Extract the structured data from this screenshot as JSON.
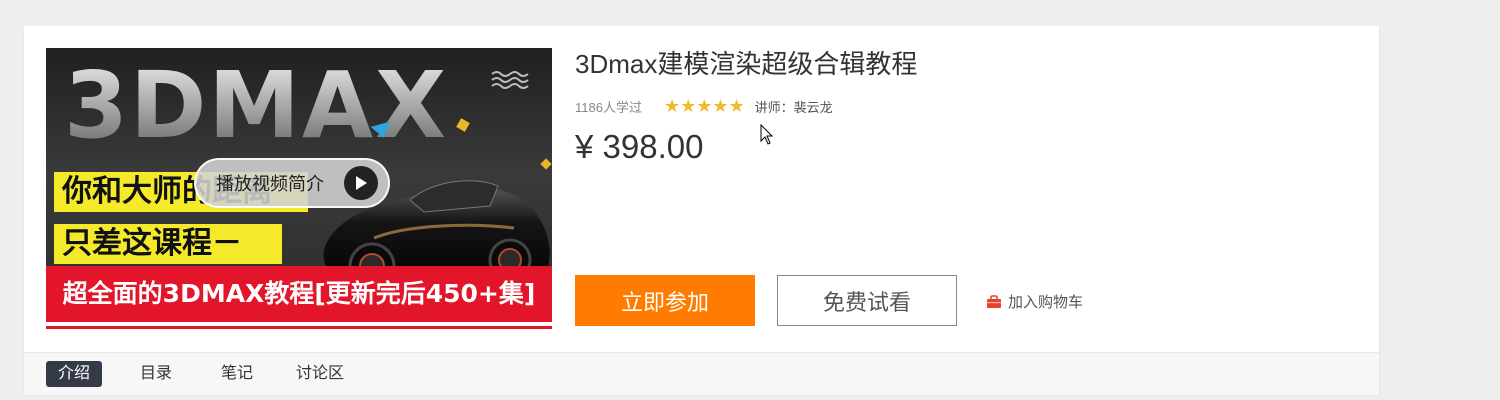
{
  "cover": {
    "big_text": "3DMAX",
    "band_1": "你和大师的距离",
    "band_2": "只差这课程－",
    "band_bottom": "超全面的3DMAX教程[更新完后450+集]",
    "play_label": "播放视频简介"
  },
  "course": {
    "title": "3Dmax建模渲染超级合辑教程",
    "learners": "1186人学过",
    "rating": 5,
    "teacher": "讲师：裴云龙",
    "price": "¥ 398.00"
  },
  "actions": {
    "join_label": "立即参加",
    "trial_label": "免费试看",
    "cart_label": "加入购物车"
  },
  "tabs": [
    {
      "label": "介绍",
      "active": true
    },
    {
      "label": "目录",
      "active": false
    },
    {
      "label": "笔记",
      "active": false
    },
    {
      "label": "讨论区",
      "active": false
    }
  ],
  "colors": {
    "accent": "#ff7c00",
    "star": "#f5b82a",
    "active_tab": "#343a48",
    "cart_icon": "#e8412f"
  }
}
